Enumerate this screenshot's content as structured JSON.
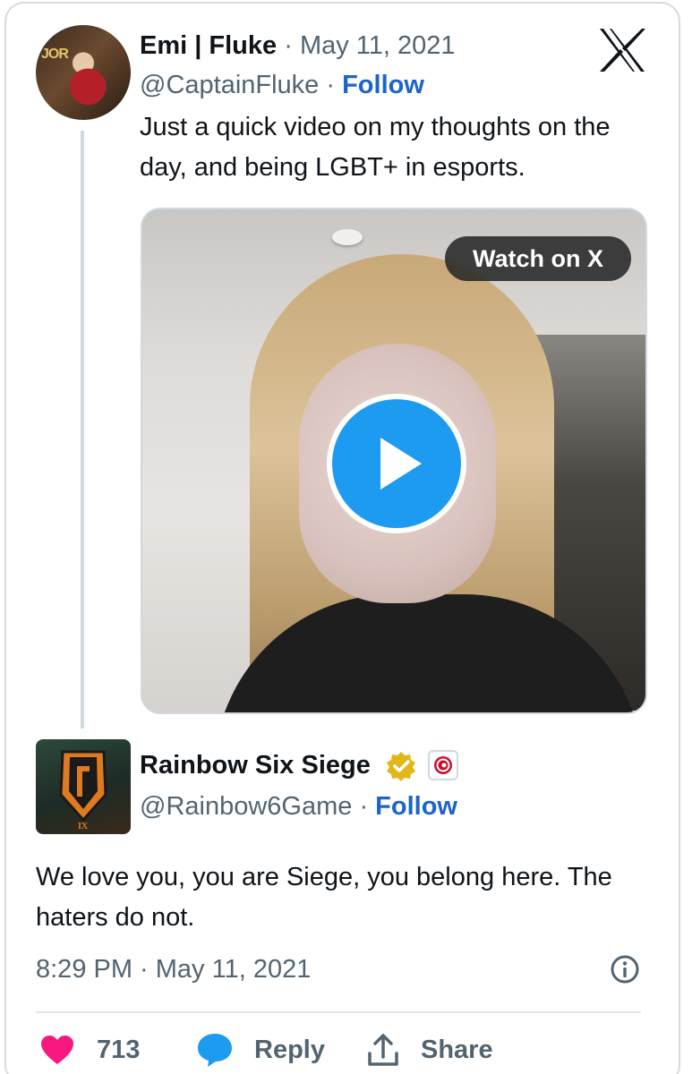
{
  "original_tweet": {
    "author_name": "Emi | Fluke",
    "date": "May 11, 2021",
    "handle": "@CaptainFluke",
    "follow_label": "Follow",
    "text": "Just a quick video on my thoughts on the day, and being LGBT+ in esports.",
    "avatar_text": "JOR",
    "video": {
      "watch_label": "Watch on X"
    }
  },
  "main_tweet": {
    "author_name": "Rainbow Six Siege",
    "handle": "@Rainbow6Game",
    "follow_label": "Follow",
    "text": "We love you, you are Siege, you belong here. The haters do not.",
    "timestamp": "8:29 PM · May 11, 2021",
    "avatar_sub": "IX"
  },
  "actions": {
    "like_count": "713",
    "reply_label": "Reply",
    "share_label": "Share"
  },
  "colors": {
    "like": "#f91880",
    "reply": "#1d9bf0",
    "link": "#1d64c9",
    "play": "#1d9bf0",
    "verified": "#e2b719"
  },
  "icons": [
    "x-logo-icon",
    "play-icon",
    "verified-badge-icon",
    "affiliate-badge-icon",
    "info-icon",
    "heart-icon",
    "reply-bubble-icon",
    "share-icon"
  ]
}
